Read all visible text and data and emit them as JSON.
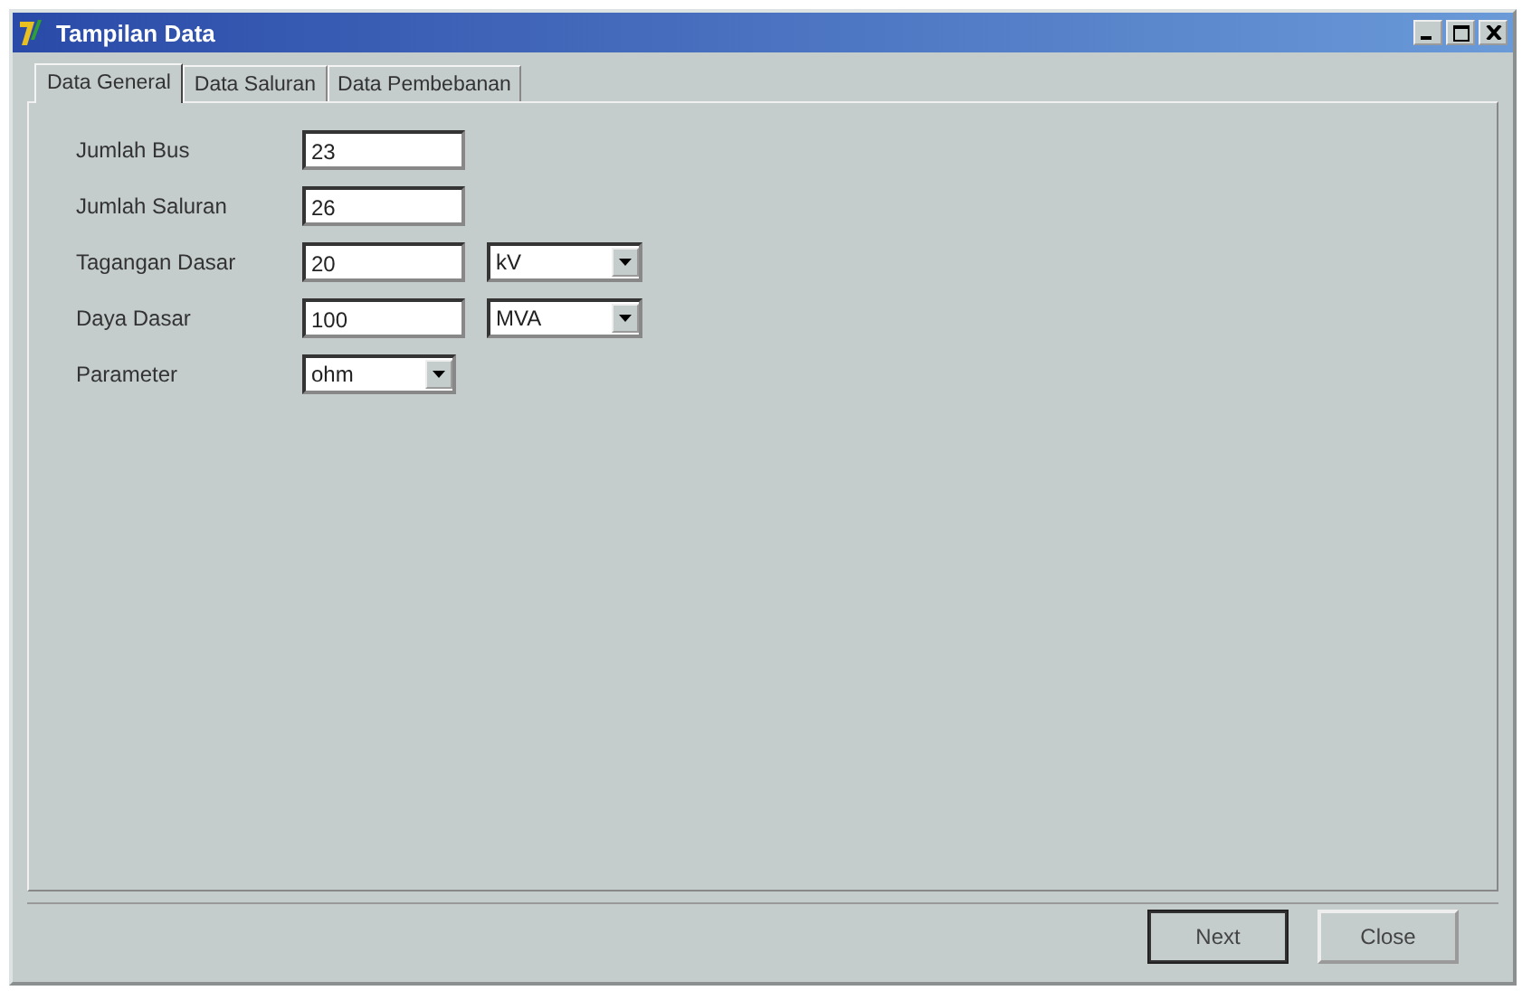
{
  "window": {
    "title": "Tampilan Data"
  },
  "tabs": [
    {
      "label": "Data General",
      "selected": true
    },
    {
      "label": "Data Saluran",
      "selected": false
    },
    {
      "label": "Data Pembebanan",
      "selected": false
    }
  ],
  "fields": [
    {
      "label": "Jumlah Bus",
      "kind": "text",
      "value": "23"
    },
    {
      "label": "Jumlah Saluran",
      "kind": "text",
      "value": "26"
    },
    {
      "label": "Tagangan Dasar",
      "kind": "text",
      "value": "20",
      "unit": "kV"
    },
    {
      "label": "Daya Dasar",
      "kind": "text",
      "value": "100",
      "unit": "MVA"
    },
    {
      "label": "Parameter",
      "kind": "combo",
      "value": "ohm"
    }
  ],
  "buttons": [
    {
      "label": "Next",
      "default": true
    },
    {
      "label": "Close",
      "default": false
    }
  ]
}
